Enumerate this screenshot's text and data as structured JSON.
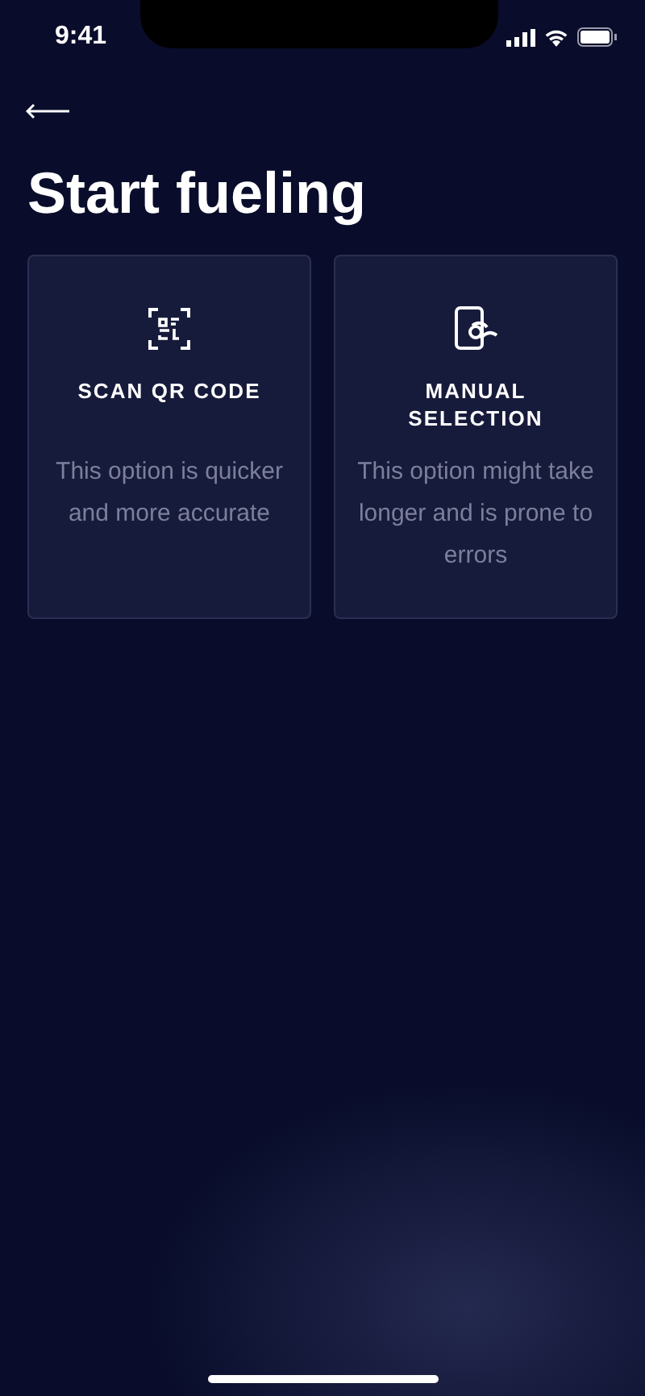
{
  "status_bar": {
    "time": "9:41"
  },
  "title": "Start fueling",
  "options": [
    {
      "kind": "qr",
      "title": "SCAN QR CODE",
      "description": "This option is quicker and more accurate"
    },
    {
      "kind": "manual",
      "title": "MANUAL SELECTION",
      "description": "This option might take longer and is prone to errors"
    }
  ]
}
